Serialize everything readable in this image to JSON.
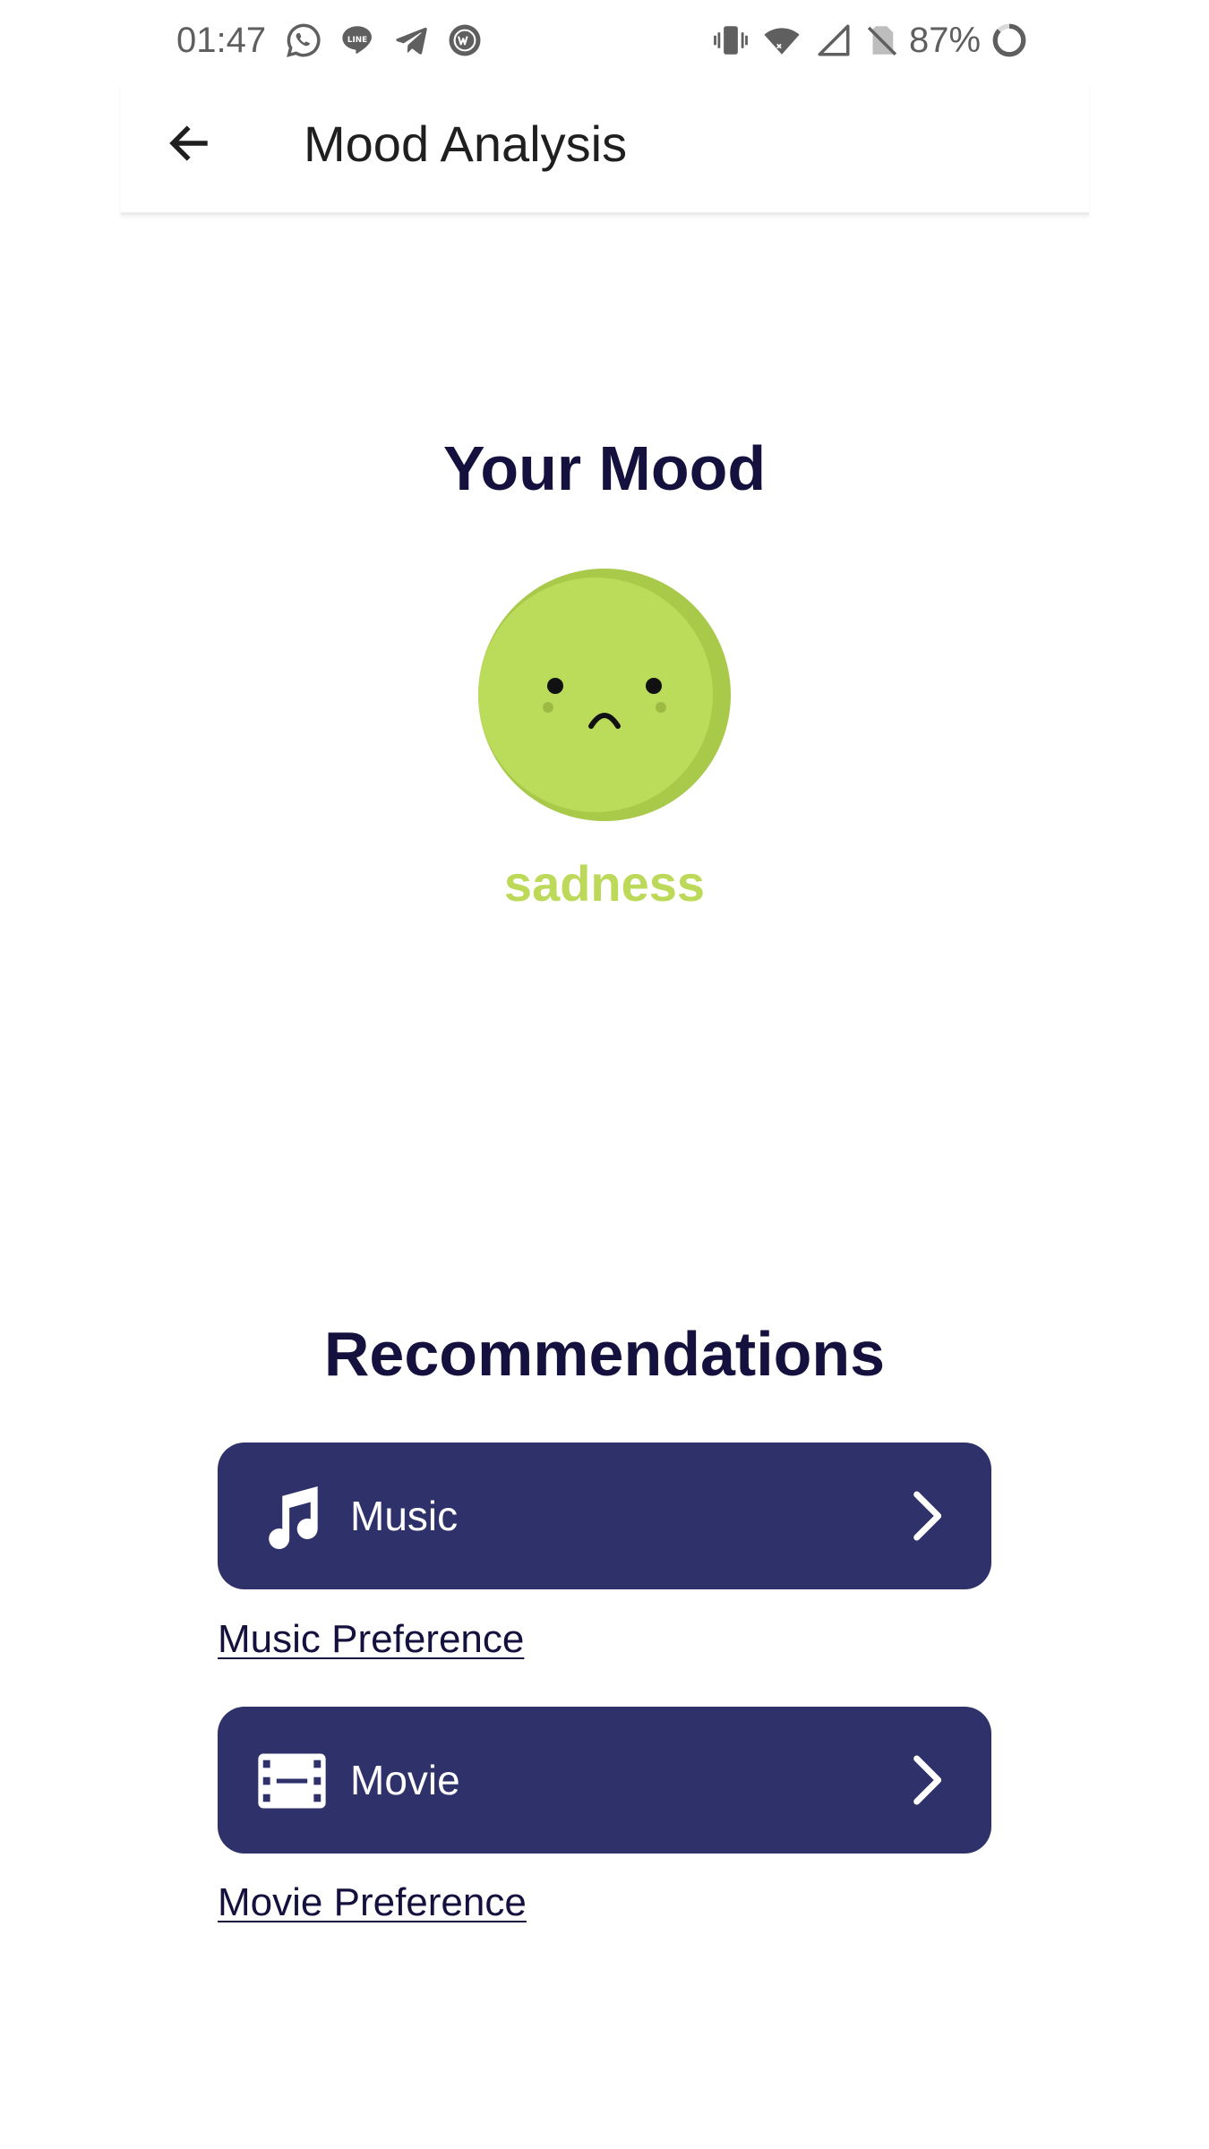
{
  "status_bar": {
    "time": "01:47",
    "battery": "87%",
    "left_icons": [
      "whatsapp-icon",
      "line-icon",
      "telegram-icon",
      "webtoon-icon"
    ],
    "right_icons": [
      "vibrate-icon",
      "wifi-icon",
      "signal-icon",
      "no-sim-icon",
      "battery-ring-icon"
    ]
  },
  "app_bar": {
    "title": "Mood Analysis",
    "back_icon": "arrow-left-icon"
  },
  "mood": {
    "heading": "Your Mood",
    "label": "sadness",
    "face_icon": "sad-face-icon",
    "face_color": "#bbdb5b",
    "label_color": "#bdd95a"
  },
  "recommendations": {
    "heading": "Recommendations",
    "items": [
      {
        "label": "Music",
        "icon": "music-note-icon",
        "link": "Music Preference"
      },
      {
        "label": "Movie",
        "icon": "film-icon",
        "link": "Movie Preference"
      }
    ],
    "button_color": "#2f316b",
    "heading_color": "#15113f"
  }
}
